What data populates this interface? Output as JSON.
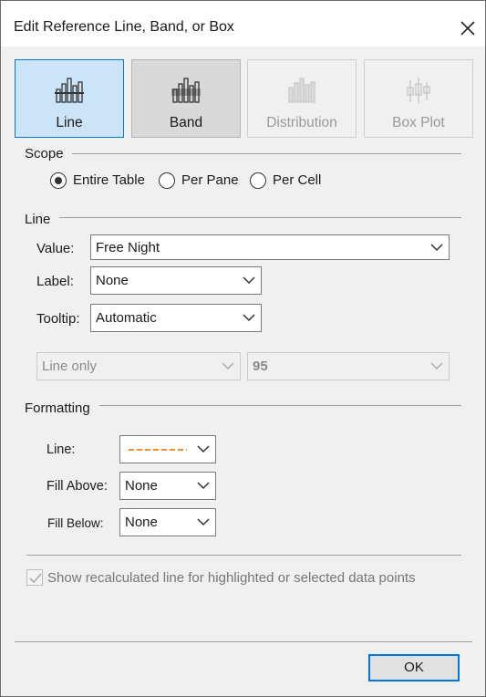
{
  "window": {
    "title": "Edit Reference Line, Band, or Box"
  },
  "types": [
    {
      "label": "Line",
      "state": "selected"
    },
    {
      "label": "Band",
      "state": "pressed"
    },
    {
      "label": "Distribution",
      "state": "disabled"
    },
    {
      "label": "Box Plot",
      "state": "disabled"
    }
  ],
  "scope": {
    "heading": "Scope",
    "options": [
      "Entire Table",
      "Per Pane",
      "Per Cell"
    ],
    "selected": "Entire Table"
  },
  "line": {
    "heading": "Line",
    "value_label": "Value:",
    "value": "Free Night",
    "label_label": "Label:",
    "label_value": "None",
    "tooltip_label": "Tooltip:",
    "tooltip_value": "Automatic",
    "line_type": "Line only",
    "confidence": "95"
  },
  "formatting": {
    "heading": "Formatting",
    "line_label": "Line:",
    "line_color": "#f28e2b",
    "fill_above_label": "Fill Above:",
    "fill_above_value": "None",
    "fill_below_label": "Fill Below:",
    "fill_below_value": "None"
  },
  "recalc": {
    "label": "Show recalculated line for highlighted or selected data points",
    "checked": true,
    "enabled": false
  },
  "buttons": {
    "ok": "OK"
  },
  "colors": {
    "accent": "#0078d7",
    "selected_bg": "#cce4f7",
    "line_sample": "#f28e2b"
  }
}
